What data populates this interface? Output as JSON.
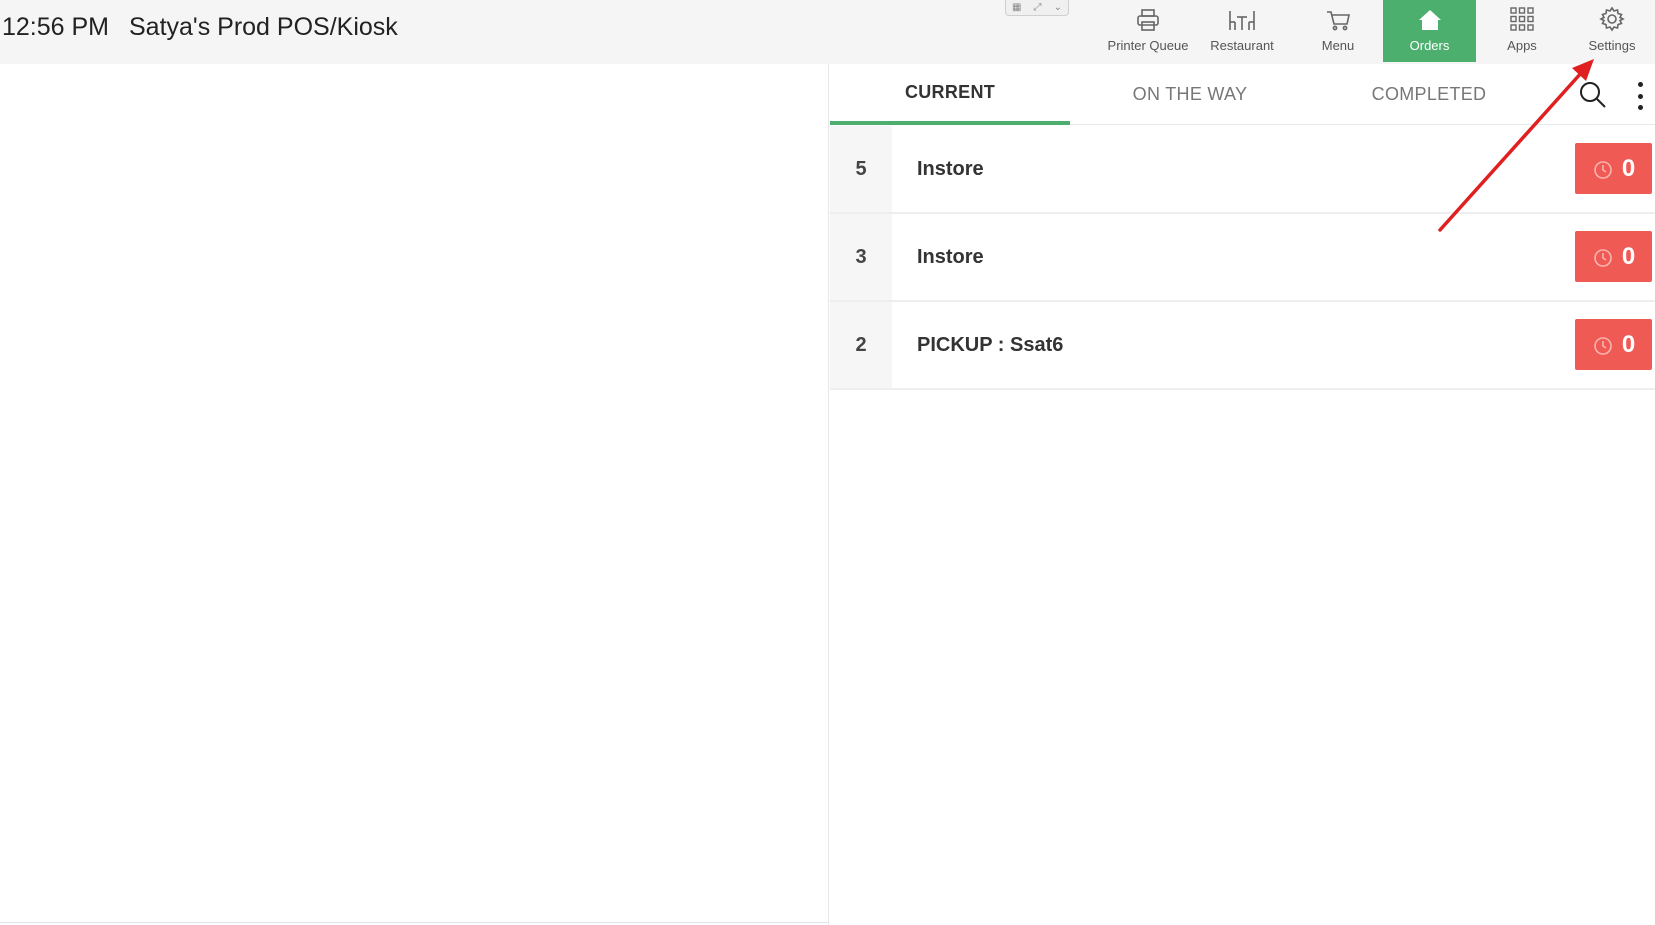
{
  "header": {
    "time": "12:56 PM",
    "store_name": "Satya's Prod POS/Kiosk"
  },
  "nav": {
    "items": [
      {
        "label": "Printer Queue",
        "icon": "printer-icon"
      },
      {
        "label": "Restaurant",
        "icon": "restaurant-icon"
      },
      {
        "label": "Menu",
        "icon": "cart-icon"
      },
      {
        "label": "Orders",
        "icon": "home-icon",
        "active": true
      },
      {
        "label": "Apps",
        "icon": "grid-icon"
      },
      {
        "label": "Settings",
        "icon": "gear-icon"
      }
    ]
  },
  "tabs": [
    {
      "label": "CURRENT",
      "active": true
    },
    {
      "label": "ON THE WAY"
    },
    {
      "label": "COMPLETED"
    }
  ],
  "orders": [
    {
      "number": "5",
      "name": "Instore",
      "timer": "0"
    },
    {
      "number": "3",
      "name": "Instore",
      "timer": "0"
    },
    {
      "number": "2",
      "name": "PICKUP : Ssat6",
      "timer": "0"
    }
  ],
  "colors": {
    "accent": "#4caf6e",
    "timer": "#ef5a55",
    "annotation_arrow": "#e02020"
  }
}
